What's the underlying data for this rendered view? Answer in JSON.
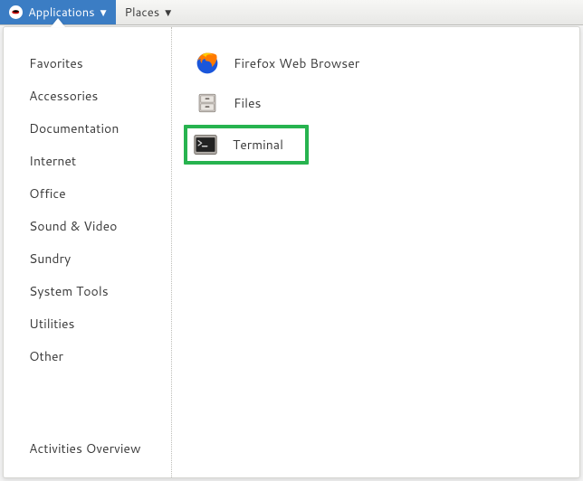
{
  "topbar": {
    "applications": "Applications",
    "places": "Places"
  },
  "categories": [
    "Favorites",
    "Accessories",
    "Documentation",
    "Internet",
    "Office",
    "Sound & Video",
    "Sundry",
    "System Tools",
    "Utilities",
    "Other"
  ],
  "activities_label": "Activities Overview",
  "apps": {
    "firefox": "Firefox Web Browser",
    "files": "Files",
    "terminal": "Terminal"
  }
}
